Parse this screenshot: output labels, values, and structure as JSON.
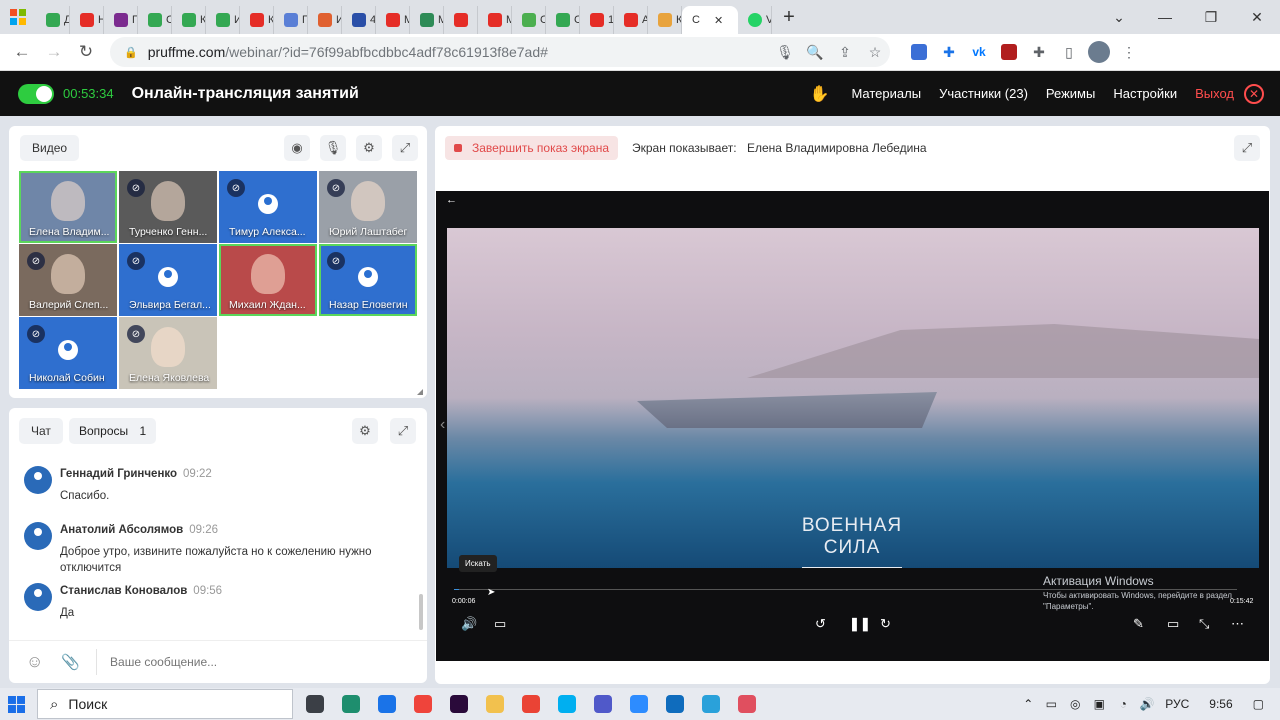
{
  "browser": {
    "tabs": [
      {
        "label": "Д",
        "color": "#34a853"
      },
      {
        "label": "Н",
        "color": "#e52d27"
      },
      {
        "label": "П",
        "color": "#7b2b8f"
      },
      {
        "label": "С",
        "color": "#34a853"
      },
      {
        "label": "К",
        "color": "#34a853"
      },
      {
        "label": "И",
        "color": "#34a853"
      },
      {
        "label": "К",
        "color": "#e52d27"
      },
      {
        "label": "П",
        "color": "#5a7fd6"
      },
      {
        "label": "И",
        "color": "#e06030"
      },
      {
        "label": "4",
        "color": "#2a4fa8"
      },
      {
        "label": "М",
        "color": "#e52d27"
      },
      {
        "label": "М",
        "color": "#2e8b57"
      },
      {
        "label": "",
        "color": "#e52d27"
      },
      {
        "label": "М",
        "color": "#e52d27"
      },
      {
        "label": "С",
        "color": "#4caf50"
      },
      {
        "label": "С",
        "color": "#34a853"
      },
      {
        "label": "1",
        "color": "#e52d27"
      },
      {
        "label": "А",
        "color": "#e52d27"
      },
      {
        "label": "К",
        "color": "#e8a33d"
      }
    ],
    "active_tab": {
      "label": "С"
    },
    "next_tab": {
      "label": "V",
      "color": "#25d366"
    },
    "new_tab_icon": "+",
    "url_host": "pruffme.com",
    "url_path": "/webinar/?id=76f99abfbcdbbc4adf78c61913f8e7ad#"
  },
  "app": {
    "timer": "00:53:34",
    "title": "Онлайн-трансляция занятий",
    "nav": {
      "materials": "Материалы",
      "participants": "Участники (23)",
      "modes": "Режимы",
      "settings": "Настройки",
      "exit": "Выход"
    }
  },
  "video_panel": {
    "label": "Видео",
    "participants": [
      {
        "name": "Елена Владим...",
        "type": "photo",
        "muted": false,
        "highlight": true,
        "bg": "#6f86a8"
      },
      {
        "name": "Турченко Генн...",
        "type": "photo",
        "muted": true,
        "highlight": false,
        "bg": "#5a5a5a"
      },
      {
        "name": "Тимур Алекса...",
        "type": "avatar",
        "muted": true,
        "highlight": false,
        "bg": "#2f6fcf"
      },
      {
        "name": "Юрий Лаштабег",
        "type": "photo",
        "muted": true,
        "highlight": false,
        "bg": "#9aa0a8"
      },
      {
        "name": "Валерий Слеп...",
        "type": "photo",
        "muted": true,
        "highlight": false,
        "bg": "#7a6a5e"
      },
      {
        "name": "Эльвира Бегал...",
        "type": "avatar",
        "muted": true,
        "highlight": false,
        "bg": "#2f6fcf"
      },
      {
        "name": "Михаил Ждан...",
        "type": "photo",
        "muted": false,
        "highlight": true,
        "bg": "#b94a4a"
      },
      {
        "name": "Назар Еловегин",
        "type": "avatar",
        "muted": true,
        "highlight": true,
        "bg": "#2f6fcf"
      },
      {
        "name": "Николай Собин",
        "type": "avatar",
        "muted": true,
        "highlight": false,
        "bg": "#2f6fcf"
      },
      {
        "name": "Елена Яковлева",
        "type": "photo",
        "muted": true,
        "highlight": false,
        "bg": "#c9c4b8"
      }
    ]
  },
  "chat_panel": {
    "tab_chat": "Чат",
    "tab_questions": "Вопросы",
    "questions_count": "1",
    "messages": [
      {
        "author": "Геннадий Гринченко",
        "time": "09:22",
        "text": "Спасибо."
      },
      {
        "author": "Анатолий Абсолямов",
        "time": "09:26",
        "text": "Доброе утро, извините пожалуйста но к сожелению нужно отключится"
      },
      {
        "author": "Станислав Коновалов",
        "time": "09:56",
        "text": "Да"
      }
    ],
    "input_placeholder": "Ваше сообщение..."
  },
  "share_panel": {
    "stop_label": "Завершить показ экрана",
    "showing_label": "Экран показывает:",
    "presenter": "Елена Владимировна Лебедина",
    "video": {
      "overlay_line1": "ВОЕННАЯ",
      "overlay_line2": "СИЛА",
      "tooltip": "Искать",
      "time_current": "0:00:06",
      "time_total": "0:15:42",
      "progress": 0.006,
      "activation_title": "Активация Windows",
      "activation_text": "Чтобы активировать Windows, перейдите в раздел \"Параметры\"."
    }
  },
  "taskbar": {
    "search_label": "Поиск",
    "language": "РУС",
    "clock": "9:56",
    "apps": [
      {
        "name": "task-view-icon",
        "color": "#3b3f46"
      },
      {
        "name": "edge-icon",
        "color": "#1e8e6e"
      },
      {
        "name": "teamviewer-icon",
        "color": "#1a73e8"
      },
      {
        "name": "anydesk-icon",
        "color": "#ef443b"
      },
      {
        "name": "premiere-icon",
        "color": "#2a0a3a"
      },
      {
        "name": "explorer-icon",
        "color": "#f2c14e"
      },
      {
        "name": "chrome-icon",
        "color": "#ea4335"
      },
      {
        "name": "skype-icon",
        "color": "#00aff0"
      },
      {
        "name": "teams-icon",
        "color": "#5059c9"
      },
      {
        "name": "zoom-icon",
        "color": "#2d8cff"
      },
      {
        "name": "outlook-icon",
        "color": "#0f6cbd"
      },
      {
        "name": "telegram-icon",
        "color": "#2aa1da"
      },
      {
        "name": "snip-icon",
        "color": "#e04f5f"
      }
    ]
  }
}
